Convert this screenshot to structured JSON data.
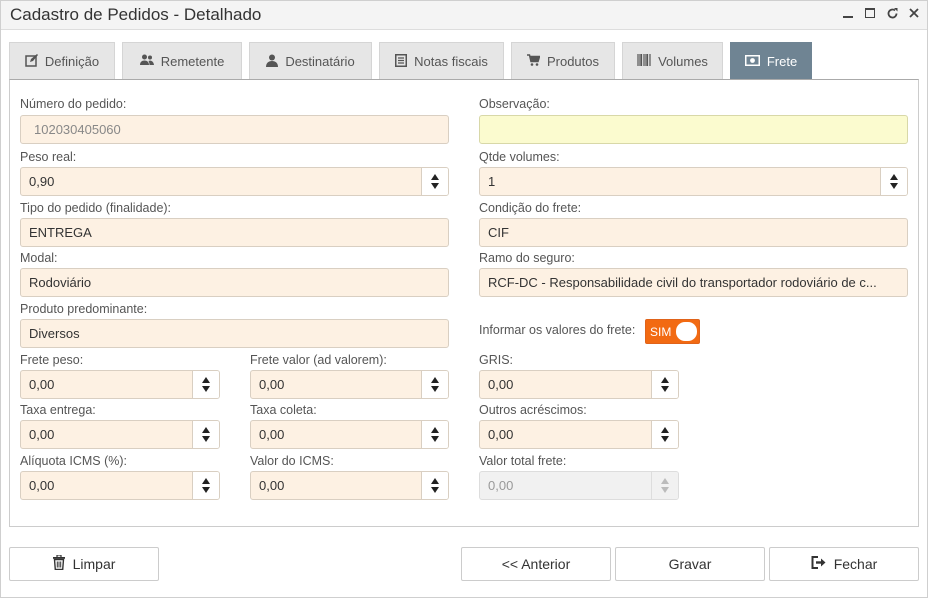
{
  "window": {
    "title": "Cadastro de Pedidos - Detalhado"
  },
  "tabs": [
    {
      "label": "Definição",
      "icon": "edit-icon"
    },
    {
      "label": "Remetente",
      "icon": "users-icon"
    },
    {
      "label": "Destinatário",
      "icon": "user-icon"
    },
    {
      "label": "Notas fiscais",
      "icon": "document-list-icon"
    },
    {
      "label": "Produtos",
      "icon": "cart-icon"
    },
    {
      "label": "Volumes",
      "icon": "barcode-icon"
    },
    {
      "label": "Frete",
      "icon": "money-icon",
      "active": true
    }
  ],
  "form": {
    "numero_pedido": {
      "label": "Número do pedido:",
      "value": "102030405060"
    },
    "observacao": {
      "label": "Observação:",
      "value": ""
    },
    "peso_real": {
      "label": "Peso real:",
      "value": "0,90"
    },
    "qtde_volumes": {
      "label": "Qtde volumes:",
      "value": "1"
    },
    "tipo_pedido": {
      "label": "Tipo do pedido (finalidade):",
      "value": "ENTREGA"
    },
    "condicao_frete": {
      "label": "Condição do frete:",
      "value": "CIF"
    },
    "modal": {
      "label": "Modal:",
      "value": "Rodoviário"
    },
    "ramo_seguro": {
      "label": "Ramo do seguro:",
      "value": "RCF-DC - Responsabilidade civil do transportador rodoviário de c..."
    },
    "produto_predominante": {
      "label": "Produto predominante:",
      "value": "Diversos"
    },
    "informar_valores": {
      "label": "Informar os valores do frete:",
      "value": "SIM"
    },
    "frete_peso": {
      "label": "Frete peso:",
      "value": "0,00"
    },
    "frete_valor": {
      "label": "Frete valor (ad valorem):",
      "value": "0,00"
    },
    "gris": {
      "label": "GRIS:",
      "value": "0,00"
    },
    "taxa_entrega": {
      "label": "Taxa entrega:",
      "value": "0,00"
    },
    "taxa_coleta": {
      "label": "Taxa coleta:",
      "value": "0,00"
    },
    "outros_acrescimos": {
      "label": "Outros acréscimos:",
      "value": "0,00"
    },
    "aliquota_icms": {
      "label": "Alíquota ICMS (%):",
      "value": "0,00"
    },
    "valor_icms": {
      "label": "Valor do ICMS:",
      "value": "0,00"
    },
    "valor_total_frete": {
      "label": "Valor total frete:",
      "value": "0,00"
    }
  },
  "buttons": {
    "limpar": "Limpar",
    "anterior": "<< Anterior",
    "gravar": "Gravar",
    "fechar": "Fechar"
  },
  "colors": {
    "active_tab": "#6f8493",
    "input_bg": "#fdf1e3",
    "observacao_bg": "#fbfbcf",
    "toggle": "#f26a12"
  }
}
